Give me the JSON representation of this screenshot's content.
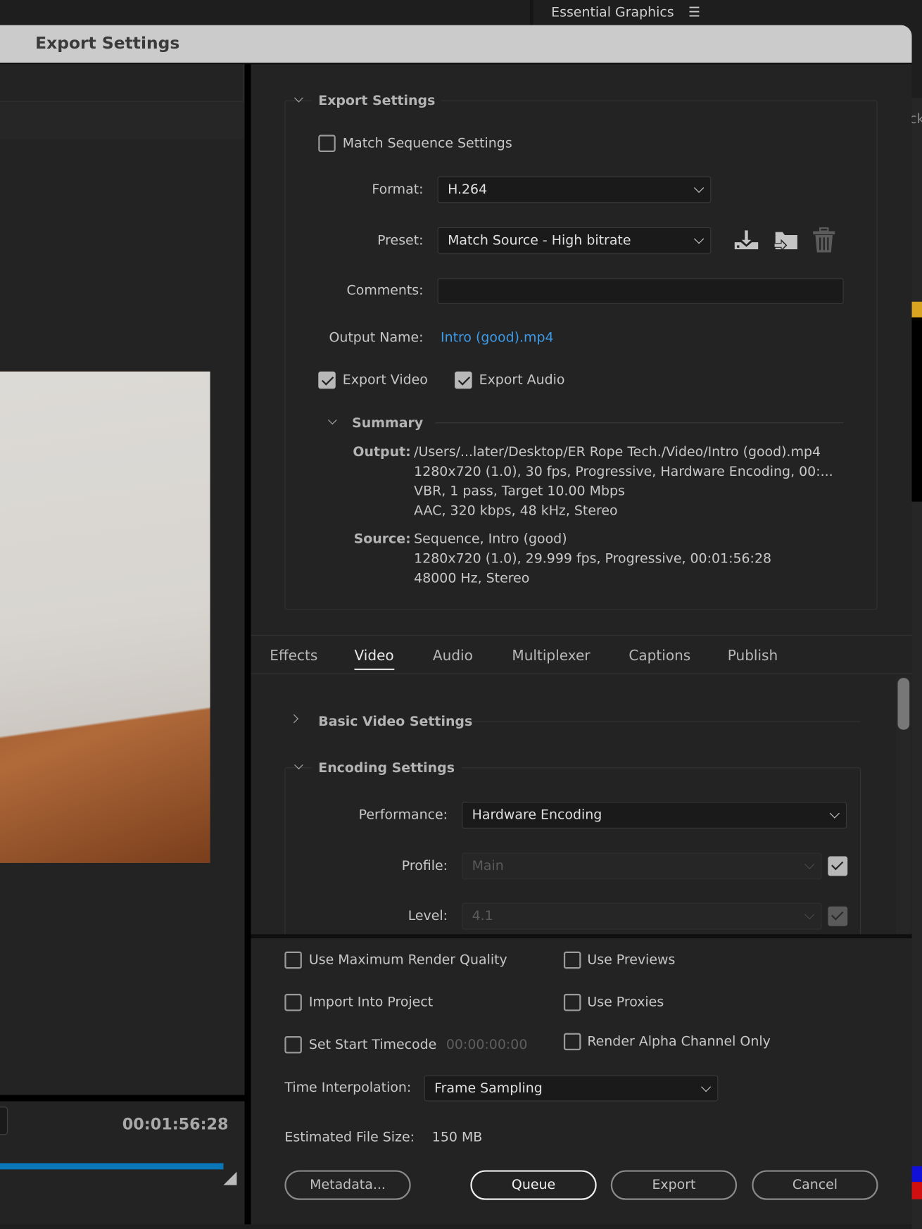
{
  "background_panel": {
    "title": "Essential Graphics",
    "menu_icon": "hamburger-icon",
    "partial_text": "ck"
  },
  "dialog": {
    "title": "Export Settings"
  },
  "preview": {
    "timecode": "00:01:56:28",
    "progress_percent": 100,
    "progress_color": "#0a75b7"
  },
  "export_settings": {
    "header": "Export Settings",
    "match_sequence": {
      "label": "Match Sequence Settings",
      "checked": false
    },
    "format": {
      "label": "Format:",
      "value": "H.264"
    },
    "preset": {
      "label": "Preset:",
      "value": "Match Source - High bitrate",
      "icons": [
        "save-preset-icon",
        "import-preset-icon",
        "delete-preset-icon"
      ]
    },
    "comments": {
      "label": "Comments:",
      "value": ""
    },
    "output_name": {
      "label": "Output Name:",
      "value": "Intro (good).mp4",
      "color": "#3d9be9"
    },
    "export_video": {
      "label": "Export Video",
      "checked": true
    },
    "export_audio": {
      "label": "Export Audio",
      "checked": true
    },
    "summary": {
      "header": "Summary",
      "output_label": "Output:",
      "output_lines": [
        "/Users/...later/Desktop/ER Rope Tech./Video/Intro (good).mp4",
        "1280x720 (1.0), 30 fps, Progressive, Hardware Encoding, 00:...",
        "VBR, 1 pass, Target 10.00 Mbps",
        "AAC, 320 kbps, 48 kHz, Stereo"
      ],
      "source_label": "Source:",
      "source_lines": [
        "Sequence, Intro (good)",
        "1280x720 (1.0), 29.999 fps, Progressive, 00:01:56:28",
        "48000 Hz, Stereo"
      ]
    }
  },
  "tabs": [
    {
      "label": "Effects"
    },
    {
      "label": "Video",
      "active": true
    },
    {
      "label": "Audio"
    },
    {
      "label": "Multiplexer"
    },
    {
      "label": "Captions"
    },
    {
      "label": "Publish"
    }
  ],
  "video_tab": {
    "basic_header": "Basic Video Settings",
    "encoding_header": "Encoding Settings",
    "performance": {
      "label": "Performance:",
      "value": "Hardware Encoding"
    },
    "profile": {
      "label": "Profile:",
      "value": "Main",
      "checked": true
    },
    "level": {
      "label": "Level:",
      "value": "4.1",
      "checked": true
    }
  },
  "bottom": {
    "use_max_render": {
      "label": "Use Maximum Render Quality",
      "checked": false
    },
    "use_previews": {
      "label": "Use Previews",
      "checked": false
    },
    "import_into_project": {
      "label": "Import Into Project",
      "checked": false
    },
    "use_proxies": {
      "label": "Use Proxies",
      "checked": false
    },
    "set_start_timecode": {
      "label": "Set Start Timecode",
      "value": "00:00:00:00",
      "checked": false
    },
    "render_alpha": {
      "label": "Render Alpha Channel Only",
      "checked": false
    },
    "time_interpolation": {
      "label": "Time Interpolation:",
      "value": "Frame Sampling"
    },
    "file_size": {
      "label": "Estimated File Size:",
      "value": "150 MB"
    },
    "buttons": {
      "metadata": "Metadata...",
      "queue": "Queue",
      "export": "Export",
      "cancel": "Cancel"
    }
  }
}
